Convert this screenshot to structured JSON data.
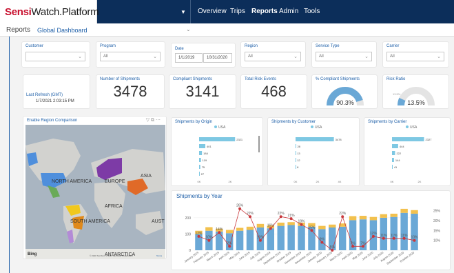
{
  "header": {
    "logo_bold": "Sensi",
    "logo_rest": "Watch.Platform",
    "nav": [
      "Overview",
      "Trips",
      "Reports",
      "Admin",
      "Tools"
    ]
  },
  "subheader": {
    "section": "Reports",
    "dashboard": "Global Dashboard"
  },
  "filters": {
    "customer": {
      "label": "Customer",
      "value": ""
    },
    "program": {
      "label": "Program",
      "value": "All"
    },
    "date": {
      "label": "Date",
      "start": "1/1/2019",
      "end": "10/31/2020"
    },
    "region": {
      "label": "Region",
      "value": "All"
    },
    "service_type": {
      "label": "Service Type",
      "value": "All"
    },
    "carrier": {
      "label": "Carrier",
      "value": "All"
    }
  },
  "refresh": {
    "label": "Last Refresh (GMT)",
    "value": "1/7/2021 2:03:15 PM"
  },
  "kpis": {
    "shipments": {
      "label": "Number of Shipments",
      "value": "3478"
    },
    "compliant": {
      "label": "Compliant Shipments",
      "value": "3141"
    },
    "risk_events": {
      "label": "Total Risk Events",
      "value": "468"
    },
    "pct_compliant": {
      "label": "% Compliant Shipments",
      "value": "90.3%",
      "fraction": 0.903
    },
    "risk_ratio": {
      "label": "Risk Ratio",
      "value": "13.5%",
      "fraction": 0.135,
      "min_label": "13.5%"
    }
  },
  "map": {
    "title": "Enable Region Comparison",
    "labels": {
      "north_america": "NORTH AMERICA",
      "europe": "EUROPE",
      "asia": "ASIA",
      "africa": "AFRICA",
      "south_america": "SOUTH AMERICA",
      "australia": "AUST",
      "antarctica": "ANTARCTICA"
    },
    "bing": "Bing",
    "copyright": "© 2020 TomTom, © 2021 Microsoft Corporation",
    "terms": "Terms"
  },
  "colors": {
    "nav": "#0c2e5a",
    "accent": "#1e5fa8",
    "bar": "#7ec8e3",
    "bar_top": "#f2c14e",
    "line": "#c9373b",
    "gauge": "#6aa8d6"
  },
  "chart_data": [
    {
      "type": "bar",
      "title": "Shipments by Origin",
      "legend": [
        "USA"
      ],
      "values": [
        2321,
        401,
        184,
        119,
        75,
        27
      ],
      "x_ticks": [
        "0K",
        "2K"
      ]
    },
    {
      "type": "bar",
      "title": "Shipments by Customer",
      "legend": [
        "USA"
      ],
      "values": [
        3478,
        28,
        13,
        12,
        8
      ],
      "x_ticks": [
        "0K",
        "2K",
        "4K"
      ]
    },
    {
      "type": "bar",
      "title": "Shipments by Carrier",
      "legend": [
        "USA"
      ],
      "values": [
        2327,
        444,
        222,
        144,
        41
      ],
      "x_ticks": [
        "0K",
        "2K"
      ]
    },
    {
      "type": "bar",
      "title": "Shipments by Year",
      "categories": [
        "January 2019",
        "February 2019",
        "March 2019",
        "April 2019",
        "May 2019",
        "June 2019",
        "July 2019",
        "August 2019",
        "September 2019",
        "October 2019",
        "November 2019",
        "December 2019",
        "January 2020",
        "February 2020",
        "March 2020",
        "April 2020",
        "May 2020",
        "June 2020",
        "July 2020",
        "August 2020",
        "September 2020",
        "October 2020"
      ],
      "series": [
        {
          "values": [
            100,
            120,
            115,
            105,
            120,
            125,
            140,
            135,
            150,
            155,
            150,
            145,
            130,
            140,
            145,
            185,
            190,
            185,
            200,
            205,
            230,
            225
          ]
        },
        {
          "values": [
            20,
            22,
            18,
            20,
            18,
            20,
            22,
            18,
            20,
            18,
            20,
            22,
            20,
            18,
            20,
            25,
            22,
            20,
            22,
            20,
            25,
            22
          ]
        },
        {
          "values": [
            12,
            10,
            14,
            7,
            26,
            22,
            10,
            16,
            22,
            21,
            18,
            15,
            9,
            5,
            22,
            7,
            7,
            12,
            11,
            11,
            11,
            10
          ]
        }
      ],
      "point_labels": [
        "12%",
        "10%",
        "14%",
        "7%",
        "26%",
        "22%",
        "10%",
        "16%",
        "22%",
        "21%",
        "18%",
        "15%",
        "9%",
        "5%",
        "22%",
        "7%",
        "7%",
        "12%",
        "11%",
        "11%",
        "11%",
        "10%"
      ],
      "y_ticks": [
        "0",
        "100",
        "200"
      ],
      "y2_ticks": [
        "10%",
        "15%",
        "20%",
        "25%"
      ]
    }
  ]
}
